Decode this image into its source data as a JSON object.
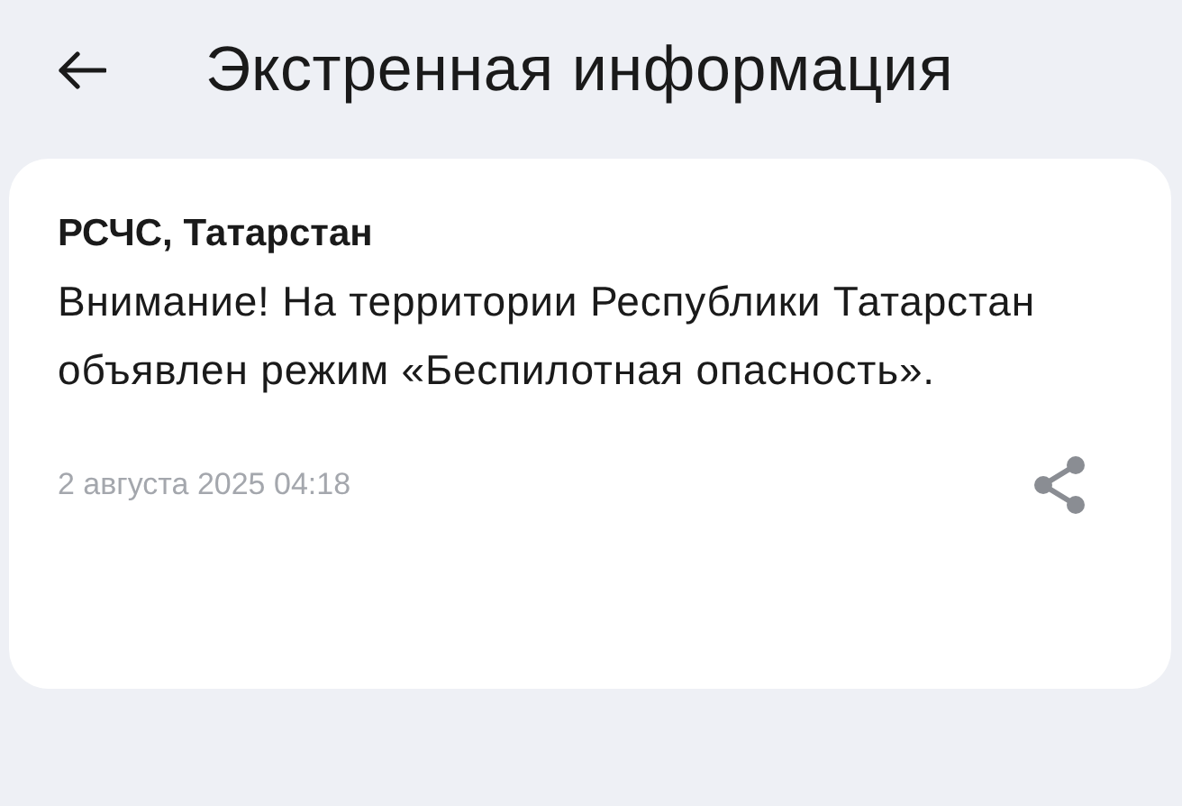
{
  "header": {
    "title": "Экстренная информация"
  },
  "message": {
    "sender": "РСЧС, Татарстан",
    "text": "Внимание! На территории Республики Татарстан объявлен режим «Беспилотная опасность».",
    "date": "2 августа 2025 04:18"
  }
}
